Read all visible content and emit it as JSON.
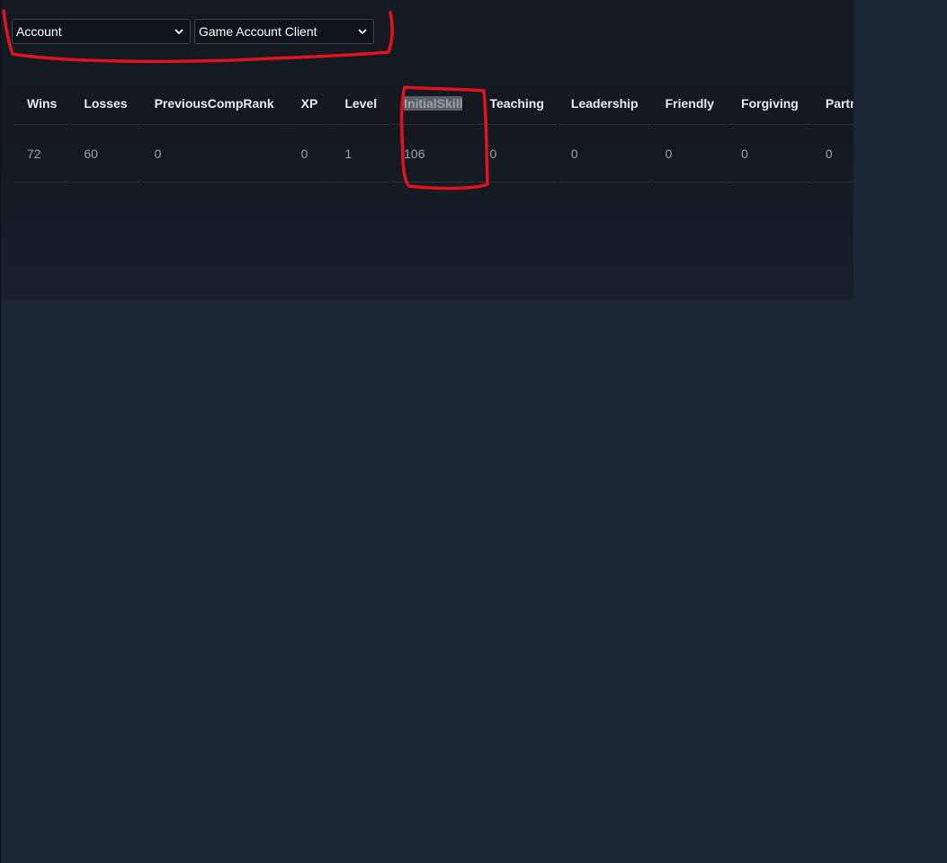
{
  "dropdowns": {
    "primary": {
      "selected": "Account"
    },
    "secondary": {
      "selected": "Game Account Client"
    }
  },
  "table": {
    "columns": [
      "Wins",
      "Losses",
      "PreviousCompRank",
      "XP",
      "Level",
      "InitialSkill",
      "Teaching",
      "Leadership",
      "Friendly",
      "Forgiving",
      "PartnerAccountT"
    ],
    "rows": [
      [
        "72",
        "60",
        "0",
        "0",
        "1",
        "106",
        "0",
        "0",
        "0",
        "0",
        "0"
      ]
    ],
    "highlighted_column": "InitialSkill"
  },
  "colors": {
    "background": "#1b2636",
    "panel": "#151a22",
    "annotation": "#e0141e"
  },
  "icons": {
    "dropdown": "chevron-down-icon"
  }
}
